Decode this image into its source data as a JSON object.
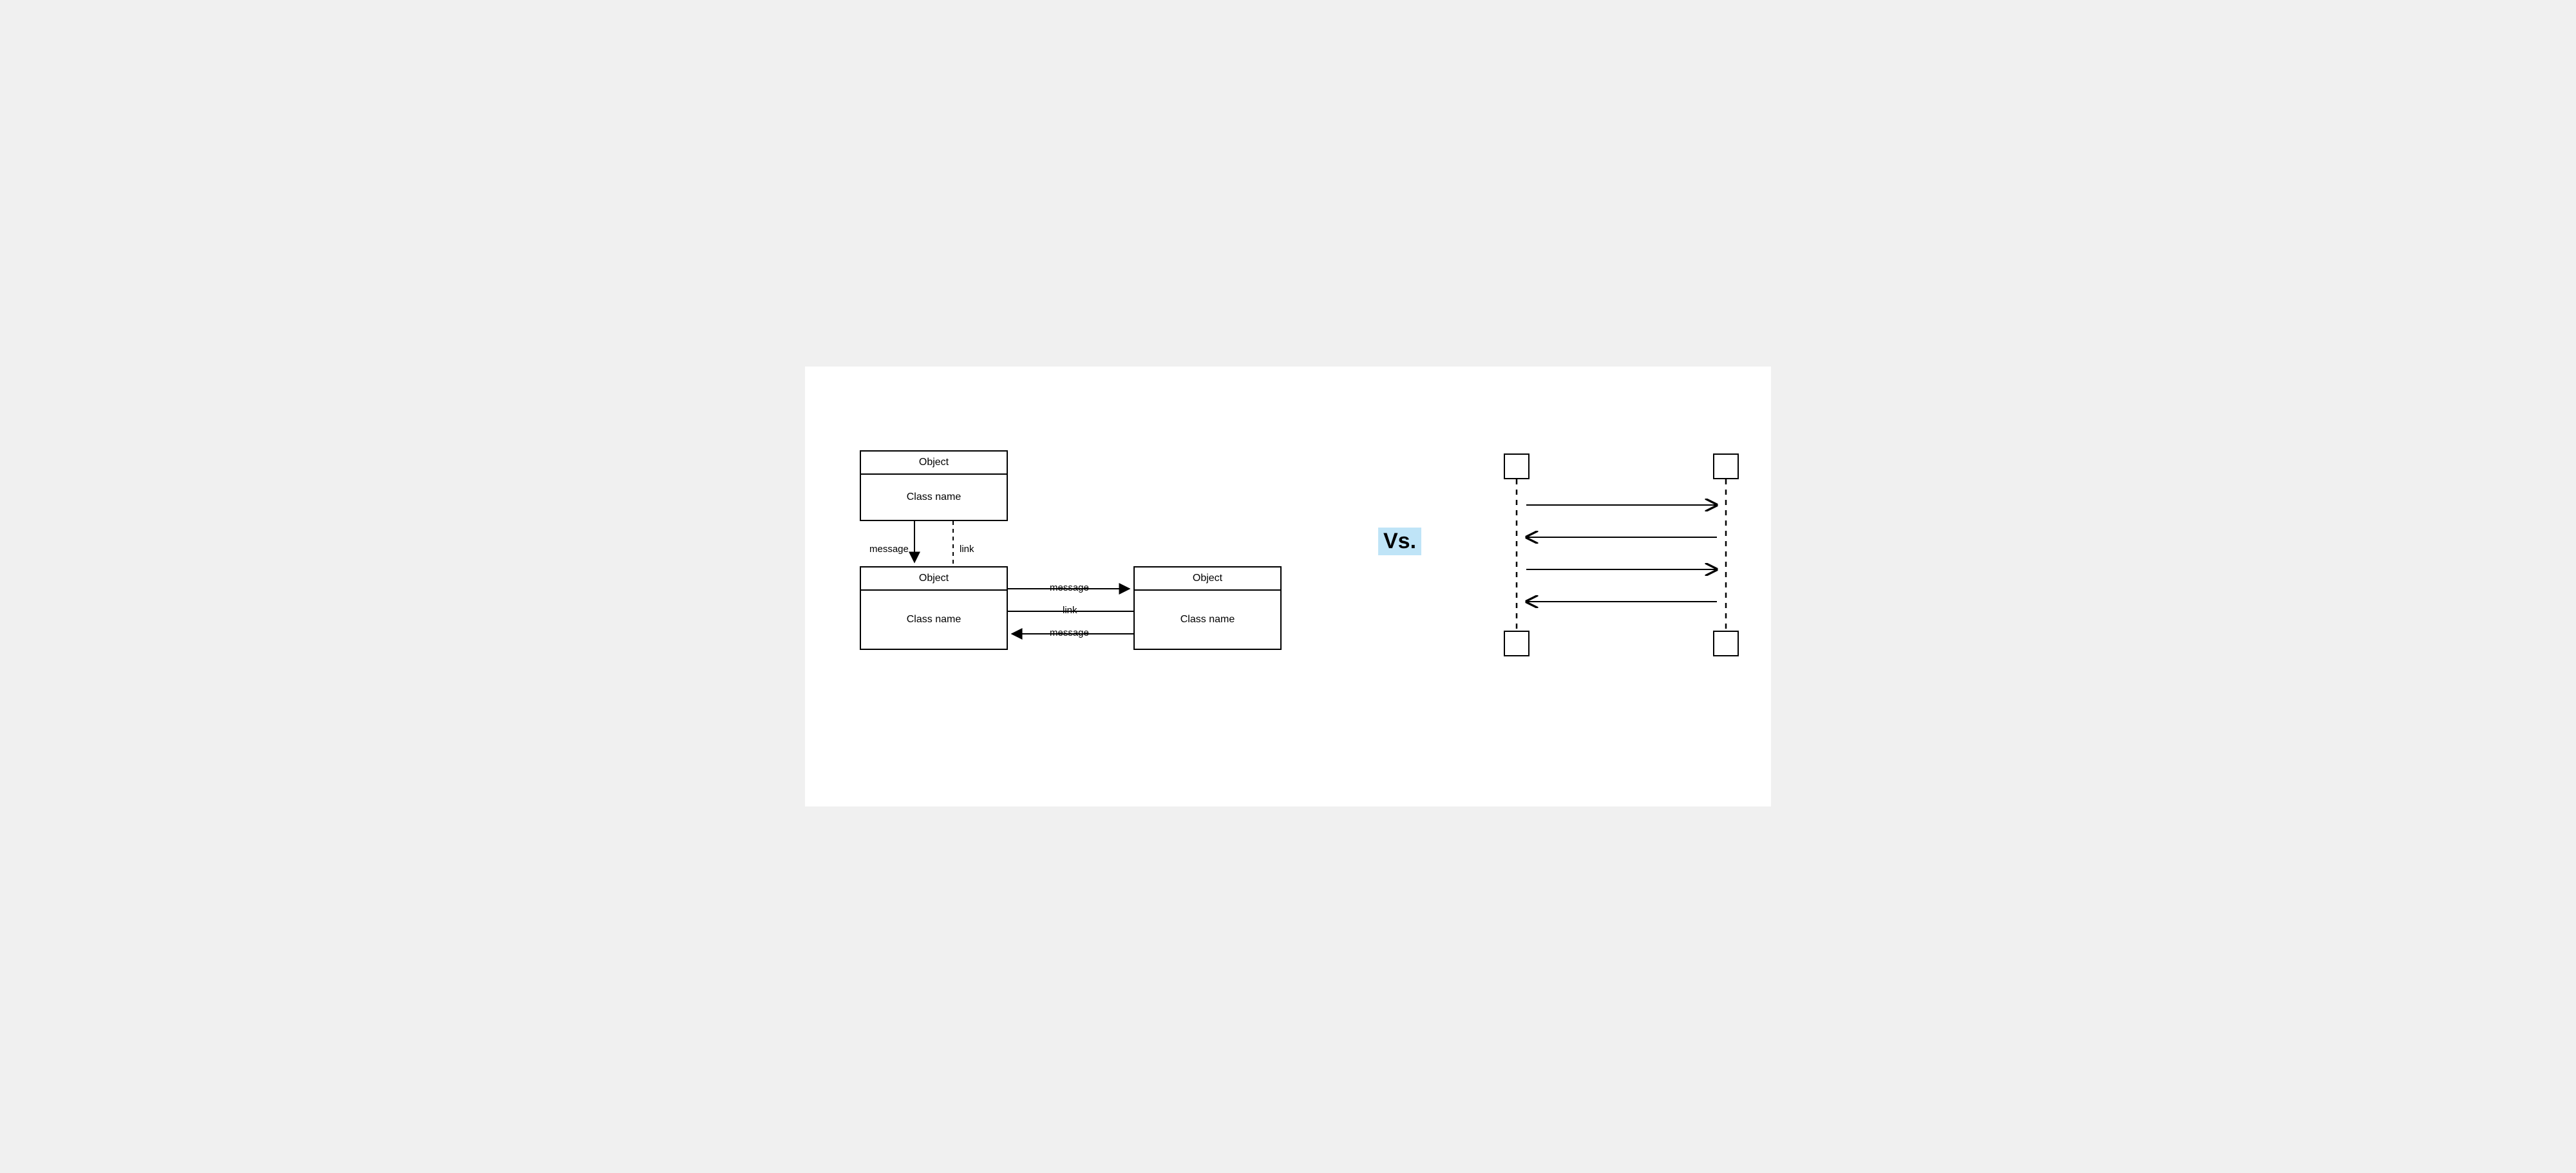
{
  "vs_label": "Vs.",
  "collaboration": {
    "box1": {
      "title": "Object",
      "body": "Class name"
    },
    "box2": {
      "title": "Object",
      "body": "Class name"
    },
    "box3": {
      "title": "Object",
      "body": "Class name"
    },
    "labels": {
      "v_message": "message",
      "v_link": "link",
      "h_message_top": "message",
      "h_link": "link",
      "h_message_bottom": "message"
    }
  },
  "sequence": {
    "lifelines": 2,
    "messages": 4
  }
}
